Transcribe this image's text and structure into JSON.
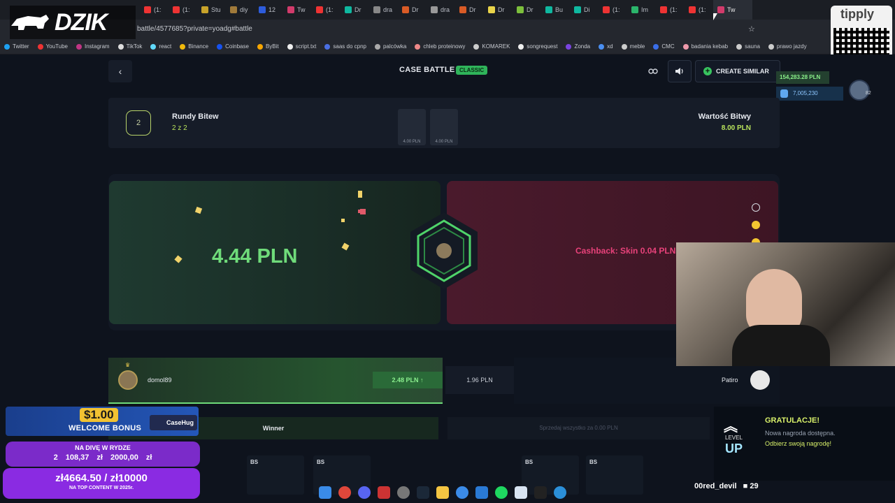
{
  "browser": {
    "url": "battle/4577685?private=yoadg#battle",
    "tabs": [
      "(1:",
      "(1:",
      "Stu",
      "diy",
      "12",
      "Tw",
      "(1:",
      "Dr",
      "dra",
      "Dr",
      "dra",
      "Dr",
      "Dr",
      "Dr",
      "Bu",
      "Di",
      "(1:",
      "Im",
      "(1:",
      "(1:",
      "Tw"
    ],
    "bookmarks": [
      "Twitter",
      "YouTube",
      "Instagram",
      "TikTok",
      "react",
      "Binance",
      "Coinbase",
      "ByBit",
      "script.txt",
      "saas do cpnp",
      "palcówka",
      "chleb proteinowy",
      "KOMAREK",
      "songrequest",
      "Zonda",
      "xd",
      "meble",
      "CMC",
      "badania kebab",
      "sauna",
      "prawo jazdy"
    ]
  },
  "logo": {
    "text": "DZIK"
  },
  "header": {
    "back": "‹",
    "title": "CASE BATTLE",
    "mode_badge": "CLASSIC",
    "link_icon": "link-icon",
    "sound_icon": "speaker-icon",
    "create_similar": "CREATE SIMILAR"
  },
  "balance": {
    "pln": "154,283.28 PLN",
    "coins": "7,005,230",
    "level": "82"
  },
  "battle_info": {
    "round_number": "2",
    "rounds_label": "Rundy Bitew",
    "rounds_value": "2 z 2",
    "cases": [
      {
        "price": "4.00 PLN"
      },
      {
        "price": "4.00 PLN"
      }
    ],
    "value_label": "Wartość Bitwy",
    "value_amount": "8.00 PLN"
  },
  "arena": {
    "green_value": "4.44 PLN",
    "red_text": "Cashback: Skin 0.04 PLN"
  },
  "players": {
    "p1": {
      "name": "domol89",
      "amount": "2.48 PLN ↑"
    },
    "p2": {
      "name": "Patiro",
      "amount": "1.96 PLN"
    },
    "winner": "Winner",
    "sell_all": "Sprzedaj wszystko za 0.00 PLN"
  },
  "items": [
    "BS",
    "BS",
    "BS",
    "BS"
  ],
  "overlay": {
    "tipply": "tipply",
    "level_word": "LEVEL",
    "level_up": "UP",
    "congrats": "GRATULACJE!",
    "congrats_sub": "Nowa nagroda dostępna.",
    "congrats_link": "Odbierz swoją nagrodę!",
    "bonus_amount": "$1.00",
    "bonus_text": "WELCOME BONUS",
    "casehug": "CaseHug",
    "diva_title": "NA DIVĘ W RYDZE",
    "diva_values": "2 108,37 zł 2000,00 zł",
    "goal_values": "zł4664.50 / zł10000",
    "goal_text": "NA TOP CONTENT W 2025r.",
    "streamer": "00red_devil",
    "viewer_count": "29"
  },
  "colors": {
    "accent_green": "#6fdb7a",
    "accent_red": "#e8427a",
    "lime": "#b9e35c"
  }
}
